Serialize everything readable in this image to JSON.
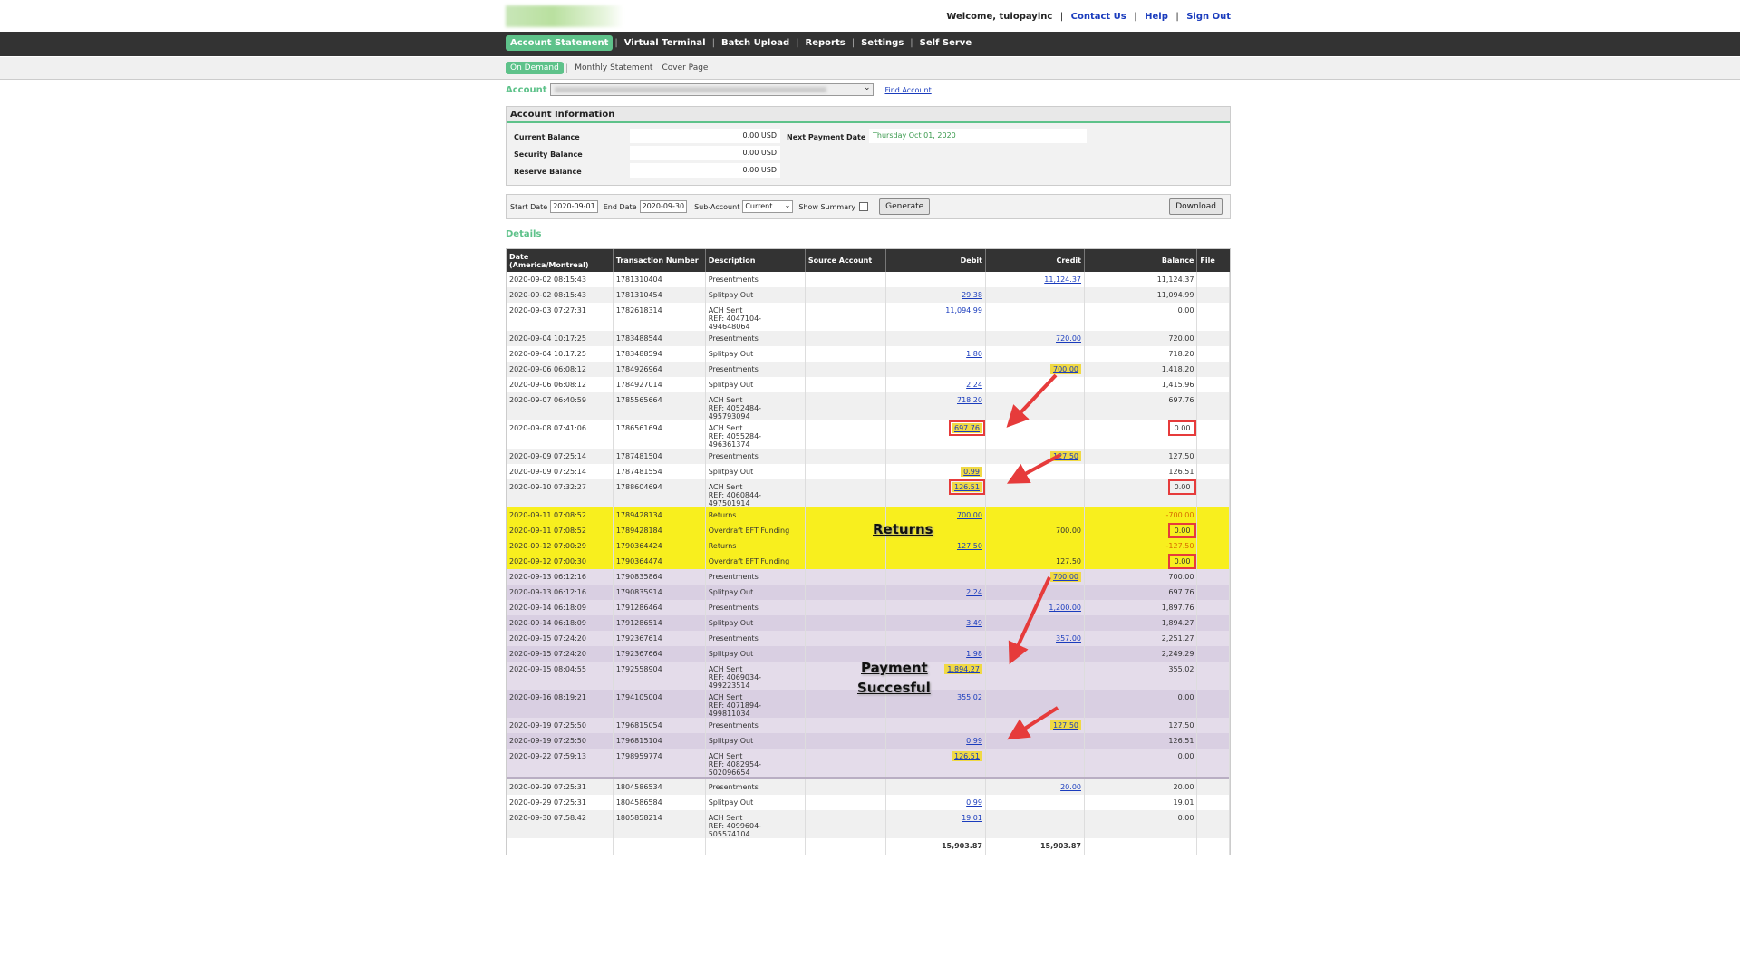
{
  "header": {
    "welcome": "Welcome, tuiopayinc",
    "links": [
      "Contact Us",
      "Help",
      "Sign Out"
    ]
  },
  "nav": [
    "Account Statement",
    "Virtual Terminal",
    "Batch Upload",
    "Reports",
    "Settings",
    "Self Serve"
  ],
  "subnav": [
    "On Demand",
    "Monthly Statement",
    "Cover Page"
  ],
  "account": {
    "label": "Account",
    "find": "Find Account"
  },
  "info": {
    "title": "Account Information",
    "current_label": "Current Balance",
    "current": "0.00 USD",
    "security_label": "Security Balance",
    "security": "0.00 USD",
    "reserve_label": "Reserve Balance",
    "reserve": "0.00 USD",
    "next_label": "Next Payment Date",
    "next": "Thursday Oct 01, 2020"
  },
  "filters": {
    "start_label": "Start Date",
    "start": "2020-09-01",
    "end_label": "End Date",
    "end": "2020-09-30",
    "sub_label": "Sub-Account",
    "sub": "Current",
    "summary_label": "Show Summary",
    "generate": "Generate",
    "download": "Download"
  },
  "details_label": "Details",
  "columns": [
    "Date (America/Montreal)",
    "Transaction Number",
    "Description",
    "Source Account",
    "Debit",
    "Credit",
    "Balance",
    "File"
  ],
  "rows": [
    {
      "date": "2020-09-02 08:15:43",
      "txn": "1781310404",
      "desc": "Presentments",
      "ref": "",
      "debit": "",
      "credit": "11,124.37",
      "bal": "11,124.37"
    },
    {
      "date": "2020-09-02 08:15:43",
      "txn": "1781310454",
      "desc": "Splitpay Out",
      "ref": "",
      "debit": "29.38",
      "credit": "",
      "bal": "11,094.99"
    },
    {
      "date": "2020-09-03 07:27:31",
      "txn": "1782618314",
      "desc": "ACH Sent",
      "ref": "REF: 4047104-494648064",
      "debit": "11,094.99",
      "credit": "",
      "bal": "0.00"
    },
    {
      "date": "2020-09-04 10:17:25",
      "txn": "1783488544",
      "desc": "Presentments",
      "ref": "",
      "debit": "",
      "credit": "720.00",
      "bal": "720.00"
    },
    {
      "date": "2020-09-04 10:17:25",
      "txn": "1783488594",
      "desc": "Splitpay Out",
      "ref": "",
      "debit": "1.80",
      "credit": "",
      "bal": "718.20"
    },
    {
      "date": "2020-09-06 06:08:12",
      "txn": "1784926964",
      "desc": "Presentments",
      "ref": "",
      "debit": "",
      "credit": "700.00",
      "bal": "1,418.20"
    },
    {
      "date": "2020-09-06 06:08:12",
      "txn": "1784927014",
      "desc": "Splitpay Out",
      "ref": "",
      "debit": "2.24",
      "credit": "",
      "bal": "1,415.96"
    },
    {
      "date": "2020-09-07 06:40:59",
      "txn": "1785565664",
      "desc": "ACH Sent",
      "ref": "REF: 4052484-495793094",
      "debit": "718.20",
      "credit": "",
      "bal": "697.76"
    },
    {
      "date": "2020-09-08 07:41:06",
      "txn": "1786561694",
      "desc": "ACH Sent",
      "ref": "REF: 4055284-496361374",
      "debit": "697.76",
      "credit": "",
      "bal": "0.00"
    },
    {
      "date": "2020-09-09 07:25:14",
      "txn": "1787481504",
      "desc": "Presentments",
      "ref": "",
      "debit": "",
      "credit": "127.50",
      "bal": "127.50"
    },
    {
      "date": "2020-09-09 07:25:14",
      "txn": "1787481554",
      "desc": "Splitpay Out",
      "ref": "",
      "debit": "0.99",
      "credit": "",
      "bal": "126.51"
    },
    {
      "date": "2020-09-10 07:32:27",
      "txn": "1788604694",
      "desc": "ACH Sent",
      "ref": "REF: 4060844-497501914",
      "debit": "126.51",
      "credit": "",
      "bal": "0.00"
    },
    {
      "date": "2020-09-11 07:08:52",
      "txn": "1789428134",
      "desc": "Returns",
      "ref": "",
      "debit": "700.00",
      "credit": "",
      "bal": "-700.00"
    },
    {
      "date": "2020-09-11 07:08:52",
      "txn": "1789428184",
      "desc": "Overdraft EFT Funding",
      "ref": "",
      "debit": "",
      "credit": "700.00",
      "bal": "0.00"
    },
    {
      "date": "2020-09-12 07:00:29",
      "txn": "1790364424",
      "desc": "Returns",
      "ref": "",
      "debit": "127.50",
      "credit": "",
      "bal": "-127.50"
    },
    {
      "date": "2020-09-12 07:00:30",
      "txn": "1790364474",
      "desc": "Overdraft EFT Funding",
      "ref": "",
      "debit": "",
      "credit": "127.50",
      "bal": "0.00"
    },
    {
      "date": "2020-09-13 06:12:16",
      "txn": "1790835864",
      "desc": "Presentments",
      "ref": "",
      "debit": "",
      "credit": "700.00",
      "bal": "700.00"
    },
    {
      "date": "2020-09-13 06:12:16",
      "txn": "1790835914",
      "desc": "Splitpay Out",
      "ref": "",
      "debit": "2.24",
      "credit": "",
      "bal": "697.76"
    },
    {
      "date": "2020-09-14 06:18:09",
      "txn": "1791286464",
      "desc": "Presentments",
      "ref": "",
      "debit": "",
      "credit": "1,200.00",
      "bal": "1,897.76"
    },
    {
      "date": "2020-09-14 06:18:09",
      "txn": "1791286514",
      "desc": "Splitpay Out",
      "ref": "",
      "debit": "3.49",
      "credit": "",
      "bal": "1,894.27"
    },
    {
      "date": "2020-09-15 07:24:20",
      "txn": "1792367614",
      "desc": "Presentments",
      "ref": "",
      "debit": "",
      "credit": "357.00",
      "bal": "2,251.27"
    },
    {
      "date": "2020-09-15 07:24:20",
      "txn": "1792367664",
      "desc": "Splitpay Out",
      "ref": "",
      "debit": "1.98",
      "credit": "",
      "bal": "2,249.29"
    },
    {
      "date": "2020-09-15 08:04:55",
      "txn": "1792558904",
      "desc": "ACH Sent",
      "ref": "REF: 4069034-499223514",
      "debit": "1,894.27",
      "credit": "",
      "bal": "355.02"
    },
    {
      "date": "2020-09-16 08:19:21",
      "txn": "1794105004",
      "desc": "ACH Sent",
      "ref": "REF: 4071894-499811034",
      "debit": "355.02",
      "credit": "",
      "bal": "0.00"
    },
    {
      "date": "2020-09-19 07:25:50",
      "txn": "1796815054",
      "desc": "Presentments",
      "ref": "",
      "debit": "",
      "credit": "127.50",
      "bal": "127.50"
    },
    {
      "date": "2020-09-19 07:25:50",
      "txn": "1796815104",
      "desc": "Splitpay Out",
      "ref": "",
      "debit": "0.99",
      "credit": "",
      "bal": "126.51"
    },
    {
      "date": "2020-09-22 07:59:13",
      "txn": "1798959774",
      "desc": "ACH Sent",
      "ref": "REF: 4082954-502096654",
      "debit": "126.51",
      "credit": "",
      "bal": "0.00"
    },
    {
      "date": "2020-09-29 07:25:31",
      "txn": "1804586534",
      "desc": "Presentments",
      "ref": "",
      "debit": "",
      "credit": "20.00",
      "bal": "20.00"
    },
    {
      "date": "2020-09-29 07:25:31",
      "txn": "1804586584",
      "desc": "Splitpay Out",
      "ref": "",
      "debit": "0.99",
      "credit": "",
      "bal": "19.01"
    },
    {
      "date": "2020-09-30 07:58:42",
      "txn": "1805858214",
      "desc": "ACH Sent",
      "ref": "REF: 4099604-505574104",
      "debit": "19.01",
      "credit": "",
      "bal": "0.00"
    }
  ],
  "totals": {
    "debit": "15,903.87",
    "credit": "15,903.87"
  },
  "annotations": {
    "returns": "Returns",
    "payment_line1": "Payment",
    "payment_line2": "Succesful"
  },
  "colors": {
    "accent": "#5ec28a",
    "highlight_row": "#f8ef1e",
    "annotation_red": "#e63b3b"
  }
}
